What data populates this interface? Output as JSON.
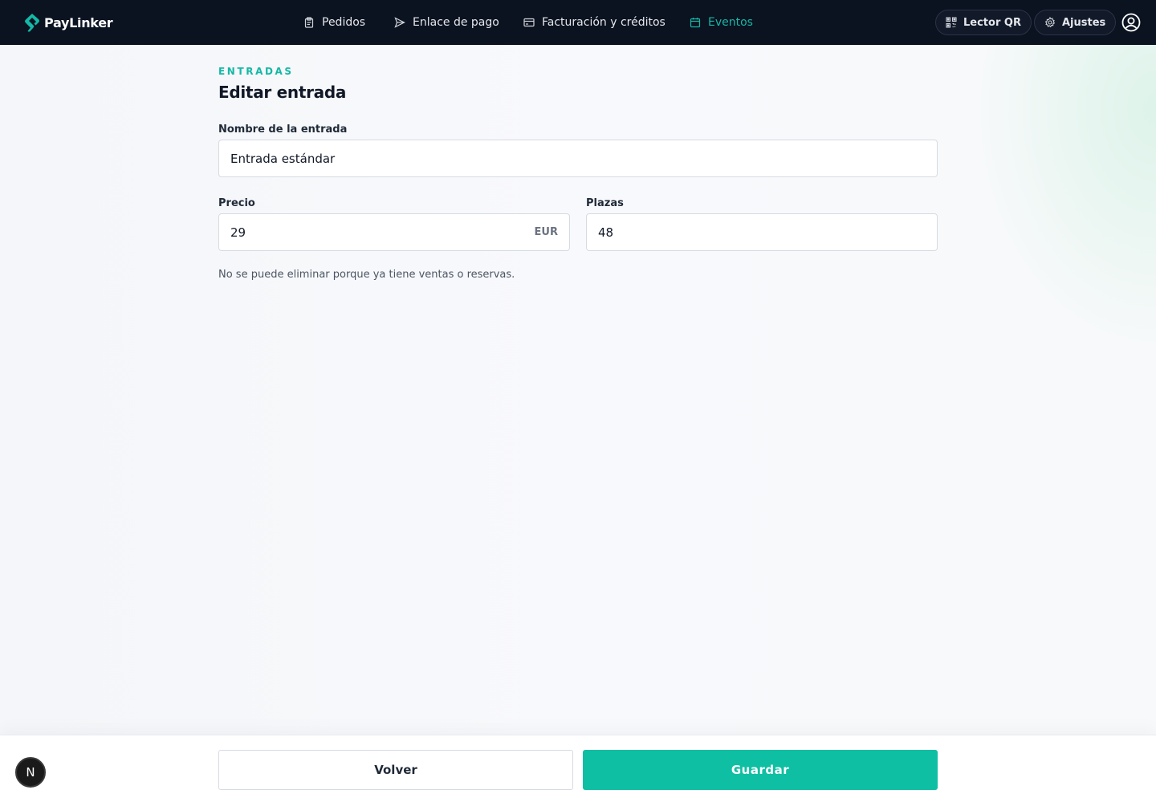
{
  "brand": {
    "name": "PayLinker",
    "accent": "#14b8a6"
  },
  "nav": {
    "items": [
      {
        "label": "Pedidos",
        "icon": "clipboard-icon",
        "active": false
      },
      {
        "label": "Enlace de pago",
        "icon": "send-icon",
        "active": false
      },
      {
        "label": "Facturación y créditos",
        "icon": "credit-card-icon",
        "active": false
      },
      {
        "label": "Eventos",
        "icon": "calendar-icon",
        "active": true
      }
    ],
    "qr_label": "Lector QR",
    "settings_label": "Ajustes"
  },
  "page": {
    "eyebrow": "ENTRADAS",
    "title": "Editar entrada"
  },
  "form": {
    "name_label": "Nombre de la entrada",
    "name_value": "Entrada estándar",
    "price_label": "Precio",
    "price_value": "29",
    "price_currency": "EUR",
    "seats_label": "Plazas",
    "seats_value": "48",
    "hint": "No se puede eliminar porque ya tiene ventas o reservas."
  },
  "footer": {
    "back_label": "Volver",
    "save_label": "Guardar",
    "badge": "N"
  },
  "colors": {
    "navbar_bg": "#0b1220",
    "primary_button": "#0fbfa3"
  }
}
